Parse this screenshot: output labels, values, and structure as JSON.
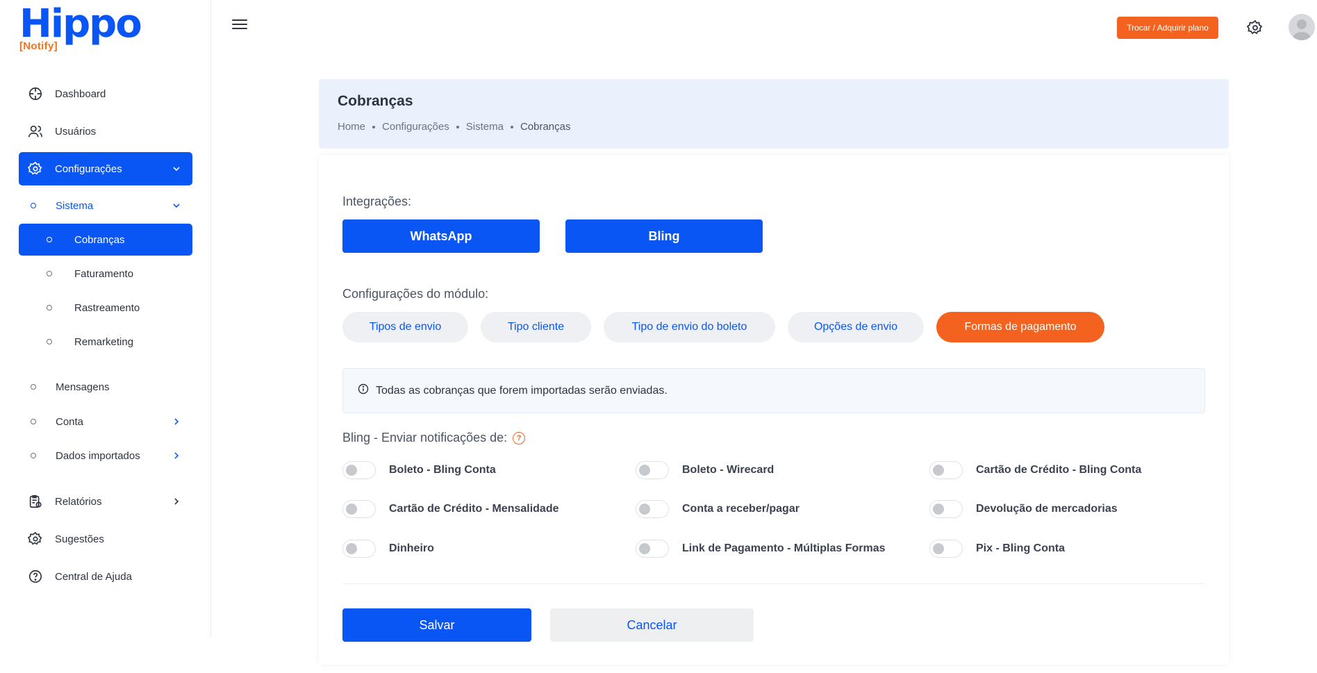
{
  "logo": {
    "main": "Hippo",
    "sub": "[Notify]"
  },
  "sidebar": {
    "items": [
      {
        "label": "Dashboard",
        "icon": "dashboard-icon"
      },
      {
        "label": "Usuários",
        "icon": "users-icon"
      },
      {
        "label": "Configurações",
        "icon": "gear-icon"
      },
      {
        "label": "Relatórios",
        "icon": "report-icon"
      },
      {
        "label": "Sugestões",
        "icon": "suggestion-gear-icon"
      },
      {
        "label": "Central de Ajuda",
        "icon": "help-icon"
      }
    ],
    "sub_items": [
      {
        "label": "Sistema"
      },
      {
        "label": "Cobranças"
      },
      {
        "label": "Faturamento"
      },
      {
        "label": "Rastreamento"
      },
      {
        "label": "Remarketing"
      },
      {
        "label": "Mensagens"
      },
      {
        "label": "Conta"
      },
      {
        "label": "Dados importados"
      }
    ]
  },
  "topbar": {
    "plan_button": "Trocar / Adquirir plano"
  },
  "header": {
    "title": "Cobranças",
    "breadcrumb": [
      "Home",
      "Configurações",
      "Sistema",
      "Cobranças"
    ]
  },
  "integrations": {
    "label": "Integrações:",
    "buttons": [
      "WhatsApp",
      "Bling"
    ]
  },
  "module_config": {
    "label": "Configurações do módulo:",
    "tabs": [
      "Tipos de envio",
      "Tipo cliente",
      "Tipo de envio do boleto",
      "Opções de envio",
      "Formas de pagamento"
    ],
    "active_tab": "Formas de pagamento"
  },
  "info": {
    "text": "Todas as cobranças que forem importadas serão enviadas."
  },
  "bling": {
    "label": "Bling - Enviar notificações de:",
    "help": "?",
    "toggles": [
      {
        "label": "Boleto - Bling Conta",
        "on": false
      },
      {
        "label": "Boleto - Wirecard",
        "on": false
      },
      {
        "label": "Cartão de Crédito - Bling Conta",
        "on": false
      },
      {
        "label": "Cartão de Crédito - Mensalidade",
        "on": false
      },
      {
        "label": "Conta a receber/pagar",
        "on": false
      },
      {
        "label": "Devolução de mercadorias",
        "on": false
      },
      {
        "label": "Dinheiro",
        "on": false
      },
      {
        "label": "Link de Pagamento - Múltiplas Formas",
        "on": false
      },
      {
        "label": "Pix - Bling Conta",
        "on": false
      }
    ]
  },
  "actions": {
    "save": "Salvar",
    "cancel": "Cancelar"
  },
  "colors": {
    "primary": "#0a56f5",
    "accent": "#f4621f"
  }
}
